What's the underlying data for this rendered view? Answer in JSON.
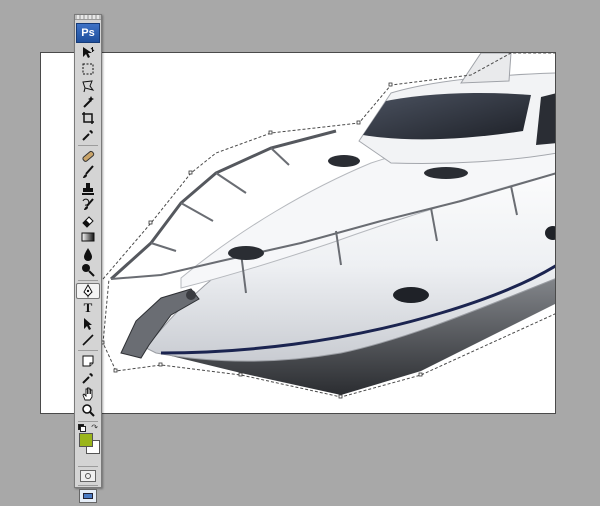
{
  "app": {
    "logo_text": "Ps",
    "name": "Adobe Photoshop"
  },
  "colors": {
    "workspace": "#a8a8a8",
    "canvas": "#ffffff",
    "foreground": "#9ab51a",
    "background": "#ffffff",
    "path_stroke": "#4a4a4a",
    "hull_stripe": "#1b2450"
  },
  "toolbar": {
    "groups": [
      [
        "move-icon",
        "marquee-icon",
        "lasso-icon",
        "magic-wand-icon",
        "crop-icon",
        "eyedropper-icon"
      ],
      [
        "healing-brush-icon",
        "brush-icon",
        "clone-stamp-icon",
        "history-brush-icon",
        "eraser-icon",
        "gradient-icon",
        "blur-icon",
        "dodge-icon"
      ],
      [
        "pen-icon",
        "type-icon",
        "path-selection-icon",
        "line-icon"
      ],
      [
        "notes-icon",
        "color-sampler-icon",
        "hand-icon",
        "zoom-icon"
      ]
    ],
    "selected_tool": "pen-icon",
    "type_tool_glyph": "T"
  }
}
